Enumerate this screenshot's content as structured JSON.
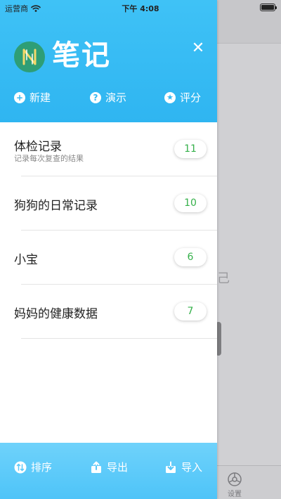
{
  "status_bar": {
    "carrier": "运营商",
    "time": "下午 4:08"
  },
  "background": {
    "partial_text": "己",
    "tab_label": "设置"
  },
  "drawer": {
    "title": "笔记",
    "header_actions": [
      {
        "label": "新建",
        "icon": "plus-circle-icon",
        "glyph": "+"
      },
      {
        "label": "演示",
        "icon": "question-circle-icon",
        "glyph": "?"
      },
      {
        "label": "评分",
        "icon": "star-circle-icon",
        "glyph": "★"
      }
    ],
    "notebooks": [
      {
        "name": "体检记录",
        "description": "记录每次复查的结果",
        "count": "11"
      },
      {
        "name": "狗狗的日常记录",
        "description": "",
        "count": "10"
      },
      {
        "name": "小宝",
        "description": "",
        "count": "6"
      },
      {
        "name": "妈妈的健康数据",
        "description": "",
        "count": "7"
      }
    ],
    "footer_actions": [
      {
        "label": "排序",
        "icon": "sort-icon"
      },
      {
        "label": "导出",
        "icon": "export-icon"
      },
      {
        "label": "导入",
        "icon": "import-icon"
      }
    ]
  },
  "colors": {
    "header_blue": "#33b8f3",
    "footer_blue": "#5ac8f9",
    "badge_green": "#35b04a",
    "logo_green": "#2e9e76"
  }
}
